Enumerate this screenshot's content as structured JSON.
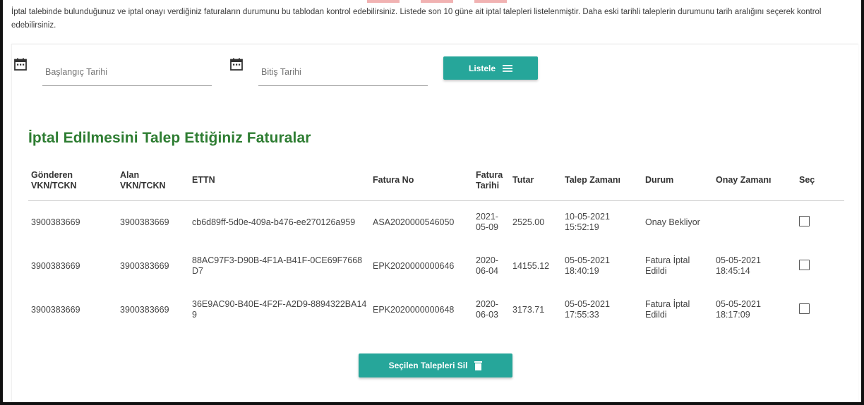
{
  "intro": "İptal talebinde bulunduğunuz ve iptal onayı verdiğiniz faturaların durumunu bu tablodan kontrol edebilirsiniz. Listede son 10 güne ait iptal talepleri listelenmiştir. Daha eski tarihli taleplerin durumunu tarih aralığını seçerek kontrol edebilirsiniz.",
  "filters": {
    "start_placeholder": "Başlangıç Tarihi",
    "end_placeholder": "Bitiş Tarihi",
    "list_button": "Listele",
    "list_icon": "list-icon",
    "calendar_icon": "calendar-icon"
  },
  "section_title": "İptal Edilmesini Talep Ettiğiniz Faturalar",
  "table": {
    "headers": [
      "Gönderen VKN/TCKN",
      "Alan VKN/TCKN",
      "ETTN",
      "Fatura No",
      "Fatura Tarihi",
      "Tutar",
      "Talep Zamanı",
      "Durum",
      "Onay Zamanı",
      "Seç"
    ],
    "rows": [
      {
        "sender": "3900383669",
        "receiver": "3900383669",
        "ettn": "cb6d89ff-5d0e-409a-b476-ee270126a959",
        "invoice_no": "ASA2020000546050",
        "invoice_date": "2021-05-09",
        "amount": "2525.00",
        "request_time": "10-05-2021 15:52:19",
        "status": "Onay Bekliyor",
        "approval_time": ""
      },
      {
        "sender": "3900383669",
        "receiver": "3900383669",
        "ettn": "88AC97F3-D90B-4F1A-B41F-0CE69F7668D7",
        "invoice_no": "EPK2020000000646",
        "invoice_date": "2020-06-04",
        "amount": "14155.12",
        "request_time": "05-05-2021 18:40:19",
        "status": "Fatura İptal Edildi",
        "approval_time": "05-05-2021 18:45:14"
      },
      {
        "sender": "3900383669",
        "receiver": "3900383669",
        "ettn": "36E9AC90-B40E-4F2F-A2D9-8894322BA149",
        "invoice_no": "EPK2020000000648",
        "invoice_date": "2020-06-03",
        "amount": "3173.71",
        "request_time": "05-05-2021 17:55:33",
        "status": "Fatura İptal Edildi",
        "approval_time": "05-05-2021 18:17:09"
      }
    ]
  },
  "delete_button": "Seçilen Talepleri Sil",
  "delete_icon": "trash-icon",
  "colors": {
    "accent": "#26a69a",
    "title_green": "#2e7d32"
  }
}
